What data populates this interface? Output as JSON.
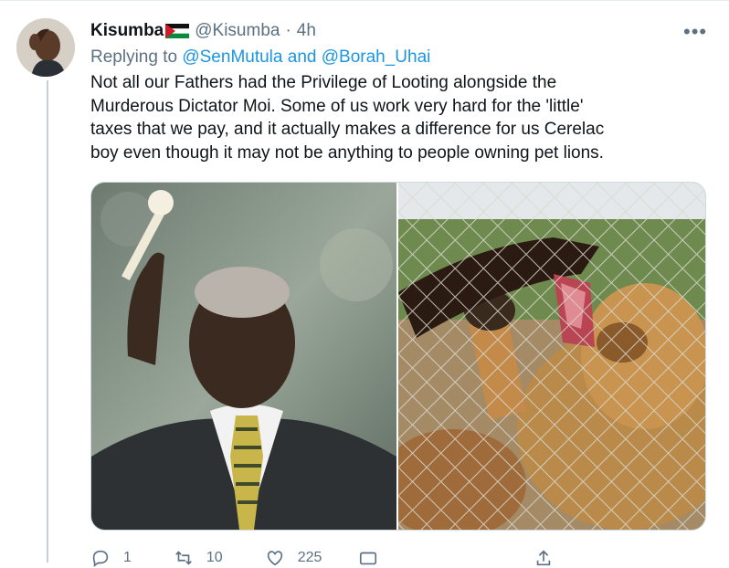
{
  "tweet": {
    "display_name": "Kisumba",
    "handle": "@Kisumba",
    "separator": "·",
    "time": "4h",
    "more_label": "•••",
    "reply_prefix": "Replying to",
    "reply_to_1": "@SenMutula",
    "reply_and": "and",
    "reply_to_2": "@Borah_Uhai",
    "text": "Not all our Fathers had the Privilege of Looting alongside the\nMurderous Dictator Moi. Some of us work very hard for the 'little'\ntaxes that we pay, and it actually makes a difference for us Cerelac\nboy even though it may not be anything to people owning pet lions."
  },
  "actions": {
    "reply_count": "1",
    "retweet_count": "10",
    "like_count": "225"
  },
  "icons": {
    "avatar": "profile-photo",
    "flag": "flag-icon",
    "reply": "reply-icon",
    "retweet": "retweet-icon",
    "like": "heart-icon",
    "share": "share-icon",
    "dm": "message-icon"
  },
  "colors": {
    "link": "#1b95e0",
    "secondary_text": "#5b7083",
    "primary_text": "#0f1419",
    "border": "#cfd9de"
  }
}
